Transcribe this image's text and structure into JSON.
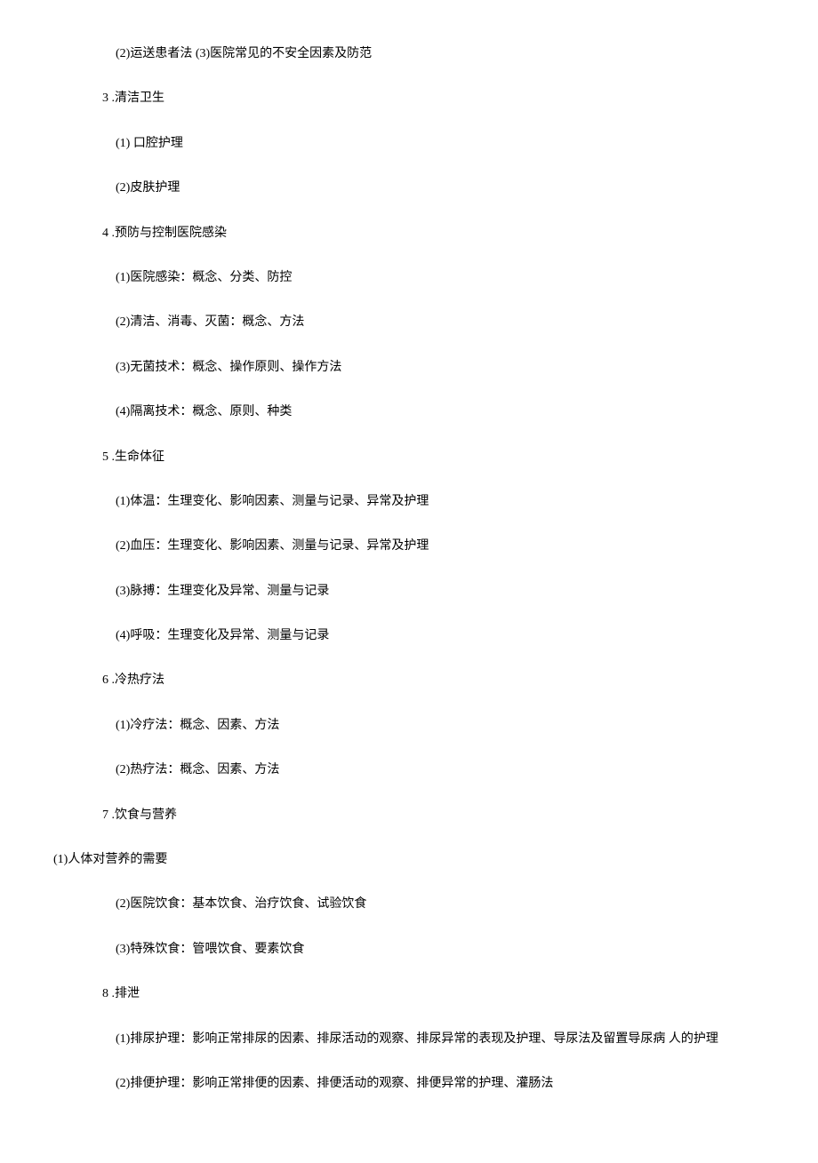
{
  "lines": [
    {
      "indent": 2,
      "text": "(2)运送患者法 (3)医院常见的不安全因素及防范"
    },
    {
      "indent": 1,
      "text": "3 .清洁卫生"
    },
    {
      "indent": 2,
      "text": "(1)   口腔护理"
    },
    {
      "indent": 2,
      "text": "(2)皮肤护理"
    },
    {
      "indent": 1,
      "text": "4 .预防与控制医院感染"
    },
    {
      "indent": 2,
      "text": "(1)医院感染：概念、分类、防控"
    },
    {
      "indent": 2,
      "text": "(2)清洁、消毒、灭菌：概念、方法"
    },
    {
      "indent": 2,
      "text": "(3)无菌技术：概念、操作原则、操作方法"
    },
    {
      "indent": 2,
      "text": "(4)隔离技术：概念、原则、种类"
    },
    {
      "indent": 1,
      "text": "5 .生命体征"
    },
    {
      "indent": 2,
      "text": "(1)体温：生理变化、影响因素、测量与记录、异常及护理"
    },
    {
      "indent": 2,
      "text": "(2)血压：生理变化、影响因素、测量与记录、异常及护理"
    },
    {
      "indent": 2,
      "text": "(3)脉搏：生理变化及异常、测量与记录"
    },
    {
      "indent": 2,
      "text": "(4)呼吸：生理变化及异常、测量与记录"
    },
    {
      "indent": 1,
      "text": "6 .冷热疗法"
    },
    {
      "indent": 2,
      "text": "(1)冷疗法：概念、因素、方法"
    },
    {
      "indent": 2,
      "text": "(2)热疗法：概念、因素、方法"
    },
    {
      "indent": 1,
      "text": "7 .饮食与营养"
    },
    {
      "indent": 0,
      "text": "(1)人体对营养的需要"
    },
    {
      "indent": 2,
      "text": "(2)医院饮食：基本饮食、治疗饮食、试验饮食"
    },
    {
      "indent": 2,
      "text": "(3)特殊饮食：管喂饮食、要素饮食"
    },
    {
      "indent": 1,
      "text": "8 .排泄"
    },
    {
      "indent": 2,
      "text": "(1)排尿护理：影响正常排尿的因素、排尿活动的观察、排尿异常的表现及护理、导尿法及留置导尿病 人的护理"
    },
    {
      "indent": 2,
      "text": "(2)排便护理：影响正常排便的因素、排便活动的观察、排便异常的护理、灌肠法"
    }
  ]
}
